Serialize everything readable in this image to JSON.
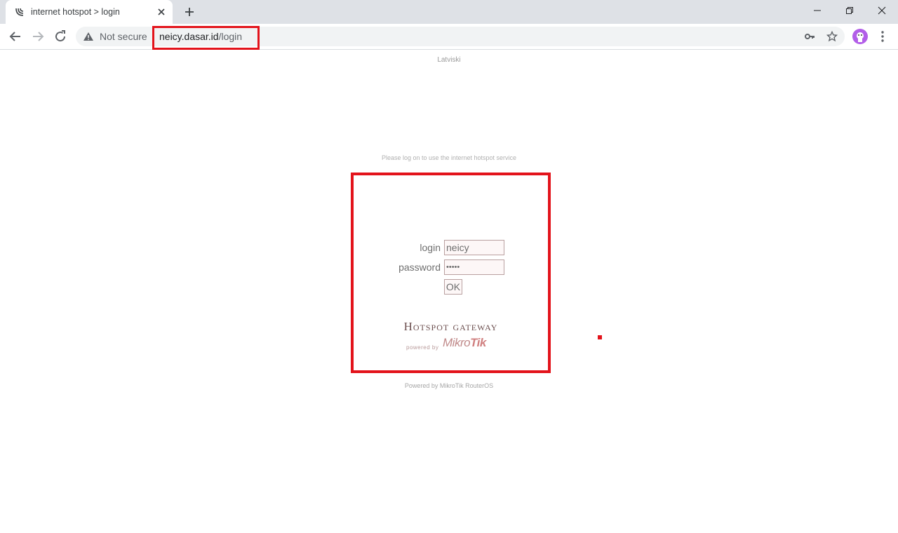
{
  "browser": {
    "tab": {
      "title": "internet hotspot > login",
      "favicon": "mikrotik-wave-icon"
    },
    "toolbar": {
      "security_label": "Not secure",
      "url_host": "neicy.dasar.id",
      "url_path": "/login"
    }
  },
  "page": {
    "language_link": "Latviski",
    "notice": "Please log on to use the internet hotspot service",
    "form": {
      "login_label": "login",
      "login_value": "neicy",
      "password_label": "password",
      "password_value": "•••••",
      "submit_label": "OK"
    },
    "brand": {
      "title": "Hotspot gateway",
      "powered_by": "powered by",
      "logo_text_a": "Mikro",
      "logo_text_b": "Tik"
    },
    "footer": "Powered by MikroTik RouterOS"
  },
  "colors": {
    "highlight": "#e3131b",
    "tabstrip": "#dee1e6",
    "omnibox": "#f1f3f4"
  }
}
